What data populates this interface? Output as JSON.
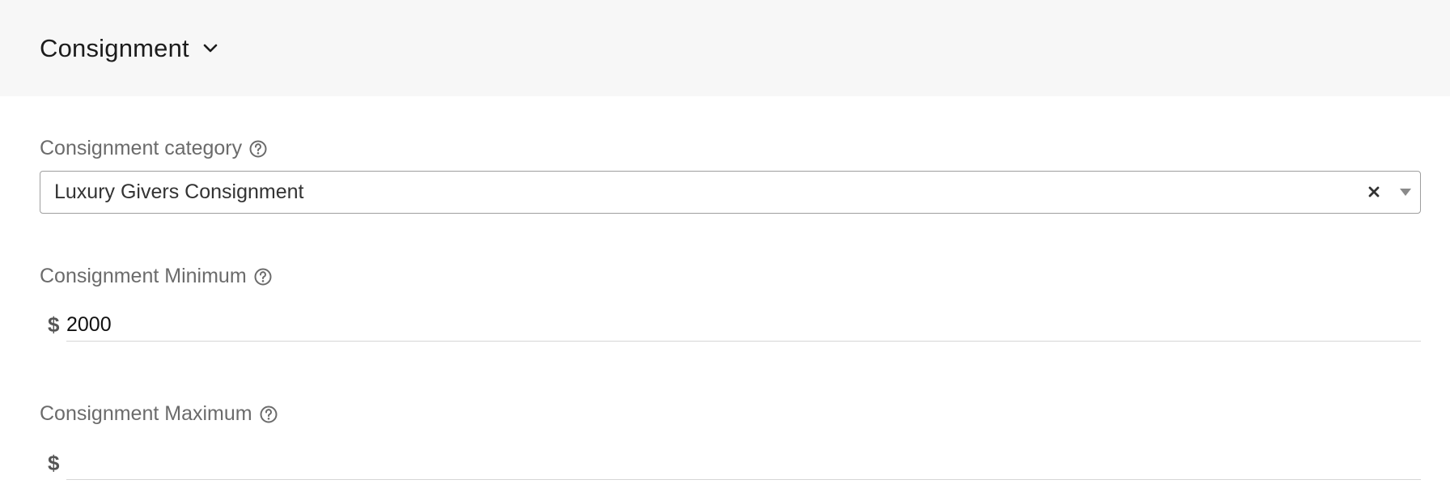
{
  "header": {
    "title": "Consignment"
  },
  "fields": {
    "category": {
      "label": "Consignment category",
      "value": "Luxury Givers Consignment"
    },
    "minimum": {
      "label": "Consignment Minimum",
      "currency": "$",
      "value": "2000",
      "placeholder": ""
    },
    "maximum": {
      "label": "Consignment Maximum",
      "currency": "$",
      "value": "",
      "placeholder": ""
    }
  },
  "icons": {
    "header_toggle": "chevron-down-icon",
    "help": "help-circle-icon",
    "clear": "close-icon",
    "dropdown": "caret-down-icon"
  },
  "colors": {
    "header_bg": "#f7f7f7",
    "label": "#6b6b6b",
    "border": "#9e9e9e",
    "underline": "#d6d6d6"
  }
}
